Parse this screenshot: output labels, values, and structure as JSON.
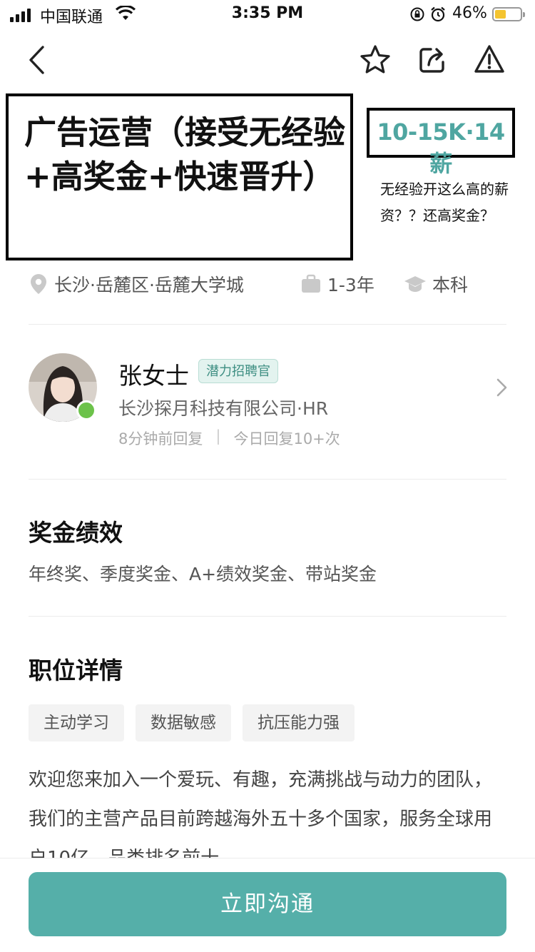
{
  "status_bar": {
    "carrier": "中国联通",
    "time": "3:35 PM",
    "battery": "46%"
  },
  "nav": {
    "icons": [
      "back-icon",
      "star-icon",
      "share-icon",
      "report-icon"
    ]
  },
  "job": {
    "title": "广告运营（接受无经验+高奖金+快速晋升）",
    "salary": "10-15K·14薪",
    "annotation": "无经验开这么高的薪资？？还高奖金？",
    "location": "长沙·岳麓区·岳麓大学城",
    "experience": "1-3年",
    "education": "本科"
  },
  "recruiter": {
    "name": "张女士",
    "badge": "潜力招聘官",
    "company": "长沙探月科技有限公司·HR",
    "reply_time": "8分钟前回复",
    "reply_count": "今日回复10+次"
  },
  "bonus": {
    "heading": "奖金绩效",
    "text": "年终奖、季度奖金、A+绩效奖金、带站奖金"
  },
  "details": {
    "heading": "职位详情",
    "tags": [
      "主动学习",
      "数据敏感",
      "抗压能力强"
    ],
    "description": "欢迎您来加入一个爱玩、有趣，充满挑战与动力的团队，我们的主营产品目前跨越海外五十多个国家，服务全球用户10亿，品类排名前十"
  },
  "cta": {
    "label": "立即沟通"
  },
  "colors": {
    "accent": "#55afa9",
    "salary": "#4fa6a1",
    "online": "#6cc24a",
    "battery": "#f4c430"
  }
}
